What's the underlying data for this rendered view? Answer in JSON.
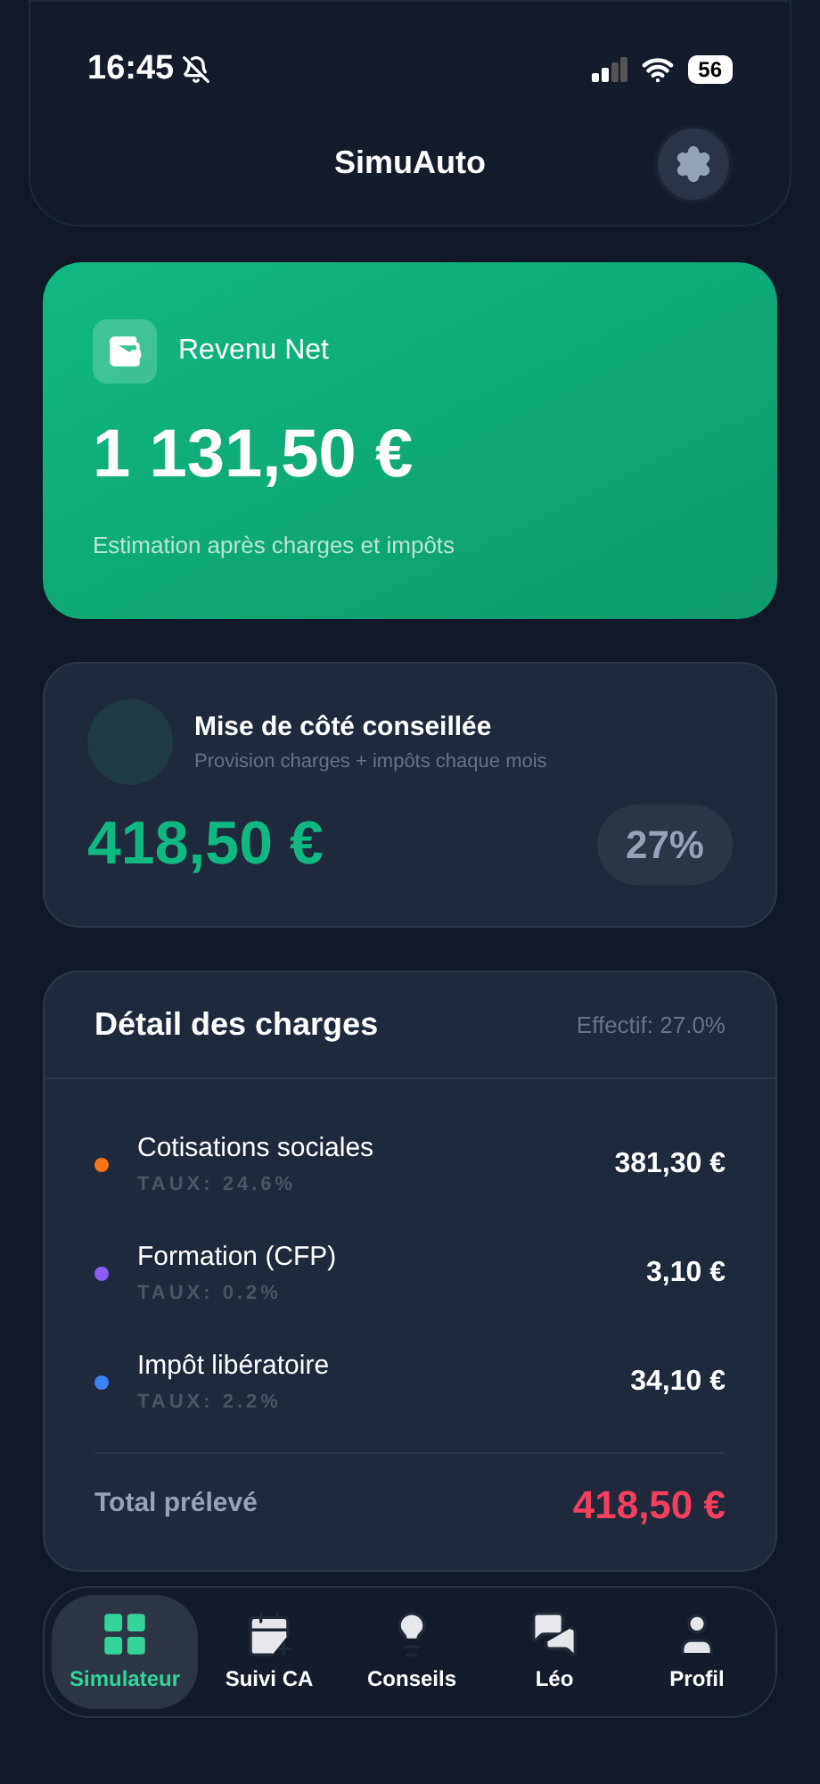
{
  "status_bar": {
    "time": "16:45",
    "battery": "56"
  },
  "header": {
    "title": "SimuAuto"
  },
  "net_income": {
    "label": "Revenu Net",
    "amount": "1 131,50 €",
    "caption": "Estimation après charges et impôts"
  },
  "savings": {
    "title": "Mise de côté conseillée",
    "subtitle": "Provision charges + impôts chaque mois",
    "amount": "418,50 €",
    "rate": "27%"
  },
  "charges": {
    "title": "Détail des charges",
    "effective": "Effectif: 27.0%",
    "items": [
      {
        "name": "Cotisations sociales",
        "rate": "TAUX: 24.6%",
        "amount": "381,30 €",
        "color": "#f97316"
      },
      {
        "name": "Formation (CFP)",
        "rate": "TAUX: 0.2%",
        "amount": "3,10 €",
        "color": "#8b5cf6"
      },
      {
        "name": "Impôt libératoire",
        "rate": "TAUX: 2.2%",
        "amount": "34,10 €",
        "color": "#3b82f6"
      }
    ],
    "total_label": "Total prélevé",
    "total": "418,50 €"
  },
  "nav": [
    {
      "kind": "grid",
      "label": "Simulateur",
      "selected": true
    },
    {
      "kind": "calendar",
      "label": "Suivi CA",
      "selected": false
    },
    {
      "kind": "bulb",
      "label": "Conseils",
      "selected": false
    },
    {
      "kind": "chat",
      "label": "Léo",
      "selected": false
    },
    {
      "kind": "person",
      "label": "Profil",
      "selected": false
    }
  ]
}
